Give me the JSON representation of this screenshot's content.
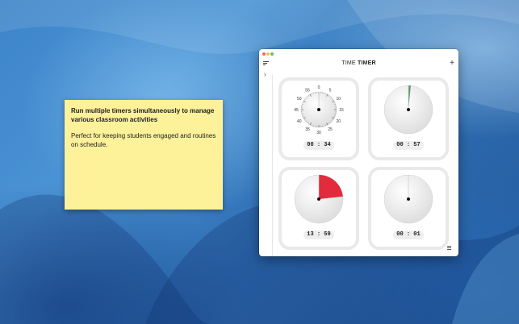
{
  "sticky_note": {
    "headline": "Run multiple timers simultaneously to manage various classroom activities",
    "body": "Perfect for keeping students engaged and routines on schedule."
  },
  "window": {
    "title_regular": "TIME ",
    "title_bold": "TIMER"
  },
  "timers": [
    {
      "display": "00 : 34",
      "color": "#e0e0e0",
      "remaining_minutes": 0.57,
      "show_dial_numbers": true
    },
    {
      "display": "00 : 57",
      "color": "#5c9a74",
      "remaining_minutes": 0.95
    },
    {
      "display": "13 : 59",
      "color": "#e22b3c",
      "remaining_minutes": 13.98
    },
    {
      "display": "00 : 01",
      "color": "#e8a2b4",
      "remaining_minutes": 0.02
    }
  ],
  "dial_numbers": [
    "0",
    "5",
    "10",
    "15",
    "20",
    "25",
    "30",
    "35",
    "40",
    "45",
    "50",
    "55"
  ],
  "dial_max_minutes": 60,
  "icons": {
    "menu": "menu-lines-icon",
    "add": "plus-icon",
    "sidebar_toggle": "chevron-right-icon",
    "list": "list-icon"
  }
}
